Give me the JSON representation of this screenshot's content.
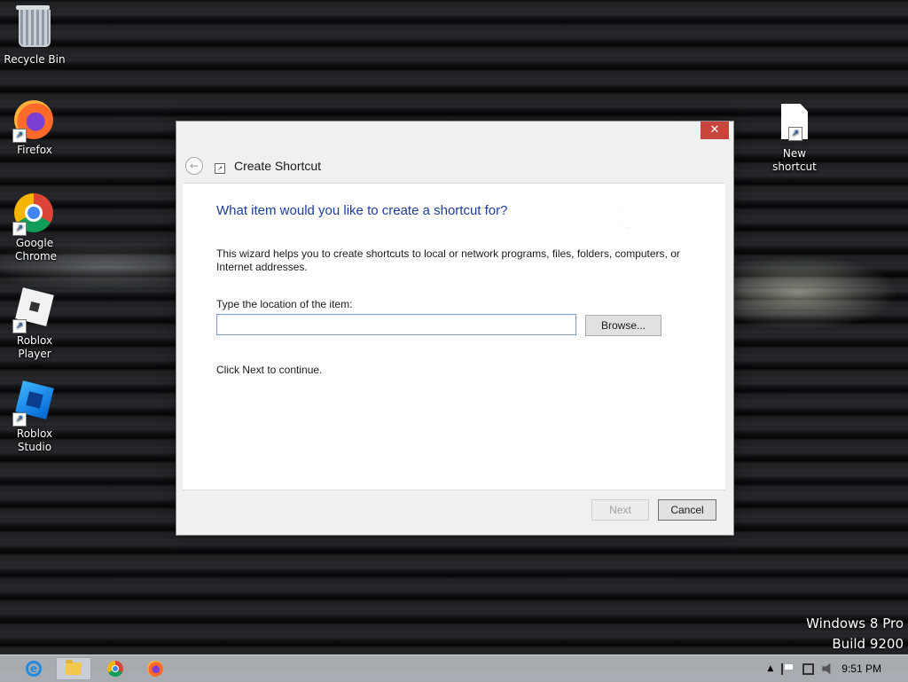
{
  "desktop": {
    "icons": [
      {
        "label": "Recycle Bin"
      },
      {
        "label": "Firefox"
      },
      {
        "label": "Google Chrome"
      },
      {
        "label": "Roblox Player"
      },
      {
        "label": "Roblox Studio"
      },
      {
        "label": "New shortcut"
      }
    ],
    "watermark": {
      "line1": "Windows 8 Pro",
      "line2": "Build 9200"
    }
  },
  "dialog": {
    "title": "Create Shortcut",
    "close_glyph": "✕",
    "heading": "What item would you like to create a shortcut for?",
    "description": "This wizard helps you to create shortcuts to local or network programs, files, folders, computers, or Internet addresses.",
    "location_label": "Type the location of the item:",
    "location_value": "",
    "browse_label": "Browse...",
    "continue_text": "Click Next to continue.",
    "next_label": "Next",
    "cancel_label": "Cancel"
  },
  "taskbar": {
    "pinned": [
      "internet-explorer-icon",
      "file-explorer-icon",
      "chrome-icon",
      "firefox-icon"
    ],
    "tray": {
      "show_hidden_glyph": "▲",
      "clock": "9:51 PM"
    }
  }
}
